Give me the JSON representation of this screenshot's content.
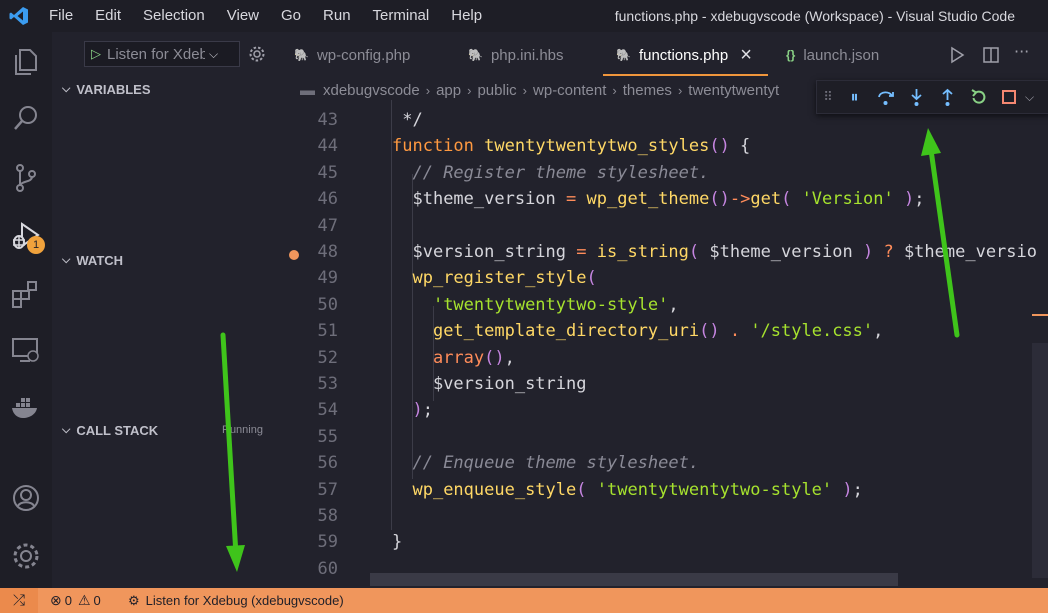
{
  "menu": [
    "File",
    "Edit",
    "Selection",
    "View",
    "Go",
    "Run",
    "Terminal",
    "Help"
  ],
  "window_title": "functions.php - xdebugvscode (Workspace) - Visual Studio Code",
  "debug": {
    "config": "Listen for Xdebug",
    "sections": {
      "variables": "VARIABLES",
      "watch": "WATCH",
      "call_stack": "CALL STACK"
    },
    "call_stack_status": "Running"
  },
  "activity": {
    "run_debug_badge": "1"
  },
  "tabs": [
    {
      "label": "wp-config.php",
      "icon": "php-elephant-icon"
    },
    {
      "label": "php.ini.hbs",
      "icon": "php-elephant-icon"
    },
    {
      "label": "functions.php",
      "icon": "php-elephant-icon",
      "active": true
    },
    {
      "label": "launch.json",
      "icon": "json-braces-icon"
    }
  ],
  "tab_close": "×",
  "breadcrumb": [
    "xdebugvscode",
    "app",
    "public",
    "wp-content",
    "themes",
    "twentytwentyt"
  ],
  "code_lines": [
    {
      "n": "43",
      "text": " */"
    },
    {
      "n": "44",
      "text": "function twentytwentytwo_styles() {"
    },
    {
      "n": "45",
      "text": "  // Register theme stylesheet."
    },
    {
      "n": "46",
      "text": "  $theme_version = wp_get_theme()->get( 'Version' );"
    },
    {
      "n": "47",
      "text": ""
    },
    {
      "n": "48",
      "text": "  $version_string = is_string( $theme_version ) ? $theme_versio"
    },
    {
      "n": "49",
      "text": "  wp_register_style("
    },
    {
      "n": "50",
      "text": "    'twentytwentytwo-style',"
    },
    {
      "n": "51",
      "text": "    get_template_directory_uri() . '/style.css',"
    },
    {
      "n": "52",
      "text": "    array(),"
    },
    {
      "n": "53",
      "text": "    $version_string"
    },
    {
      "n": "54",
      "text": "  );"
    },
    {
      "n": "55",
      "text": ""
    },
    {
      "n": "56",
      "text": "  // Enqueue theme stylesheet."
    },
    {
      "n": "57",
      "text": "  wp_enqueue_style( 'twentytwentytwo-style' );"
    },
    {
      "n": "58",
      "text": ""
    },
    {
      "n": "59",
      "text": "}"
    },
    {
      "n": "60",
      "text": ""
    }
  ],
  "breakpoint_line": "48",
  "status": {
    "errors": "0",
    "warnings": "0",
    "debug_config": "Listen for Xdebug (xdebugvscode)"
  },
  "colors": {
    "accent": "#f0965c",
    "status_bar": "#f0965c",
    "arrow": "#3fc41b",
    "keyword": "#ff9940",
    "function": "#ffd866",
    "string": "#a6e22e"
  }
}
